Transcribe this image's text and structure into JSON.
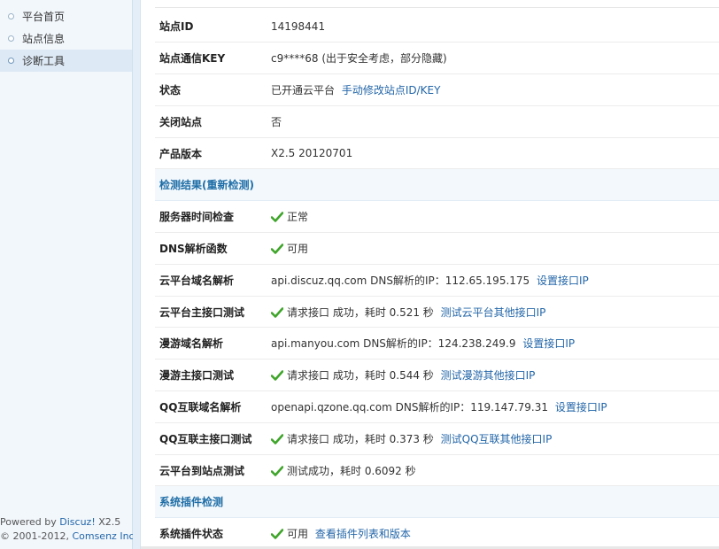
{
  "sidebar": {
    "items": [
      {
        "label": "平台首页"
      },
      {
        "label": "站点信息"
      },
      {
        "label": "诊断工具"
      }
    ],
    "footer": {
      "powered_prefix": "Powered by ",
      "product": "Discuz!",
      "version": " X2.5",
      "copyright_prefix": "© 2001-2012, ",
      "company": "Comsenz Inc."
    }
  },
  "info": {
    "site_id_label": "站点ID",
    "site_id_value": "14198441",
    "key_label": "站点通信KEY",
    "key_value": "c9****68 (出于安全考虑，部分隐藏)",
    "status_label": "状态",
    "status_value": "已开通云平台",
    "status_link": "手动修改站点ID/KEY",
    "closed_label": "关闭站点",
    "closed_value": "否",
    "version_label": "产品版本",
    "version_value": "X2.5 20120701"
  },
  "checks": {
    "section_title": "检测结果(重新检测)",
    "server_time_label": "服务器时间检查",
    "server_time_value": "正常",
    "dns_func_label": "DNS解析函数",
    "dns_func_value": "可用",
    "cloud_dns_label": "云平台域名解析",
    "cloud_dns_value": "api.discuz.qq.com DNS解析的IP：112.65.195.175",
    "cloud_dns_link": "设置接口IP",
    "cloud_api_label": "云平台主接口测试",
    "cloud_api_value": "请求接口 成功，耗时 0.521 秒",
    "cloud_api_link": "测试云平台其他接口IP",
    "manyou_dns_label": "漫游域名解析",
    "manyou_dns_value": "api.manyou.com DNS解析的IP：124.238.249.9",
    "manyou_dns_link": "设置接口IP",
    "manyou_api_label": "漫游主接口测试",
    "manyou_api_value": "请求接口 成功，耗时 0.544 秒",
    "manyou_api_link": "测试漫游其他接口IP",
    "qq_dns_label": "QQ互联域名解析",
    "qq_dns_value": "openapi.qzone.qq.com DNS解析的IP：119.147.79.31",
    "qq_dns_link": "设置接口IP",
    "qq_api_label": "QQ互联主接口测试",
    "qq_api_value": "请求接口 成功，耗时 0.373 秒",
    "qq_api_link": "测试QQ互联其他接口IP",
    "cloud_site_label": "云平台到站点测试",
    "cloud_site_value": "测试成功，耗时 0.6092 秒"
  },
  "plugins": {
    "section_title": "系统插件检测",
    "status_label": "系统插件状态",
    "status_value": "可用",
    "status_link": "查看插件列表和版本"
  },
  "colors": {
    "link": "#2366a8",
    "section_text": "#1f6ea7",
    "check_green": "#3fa52a",
    "sidebar_bg": "#f2f7fc"
  }
}
